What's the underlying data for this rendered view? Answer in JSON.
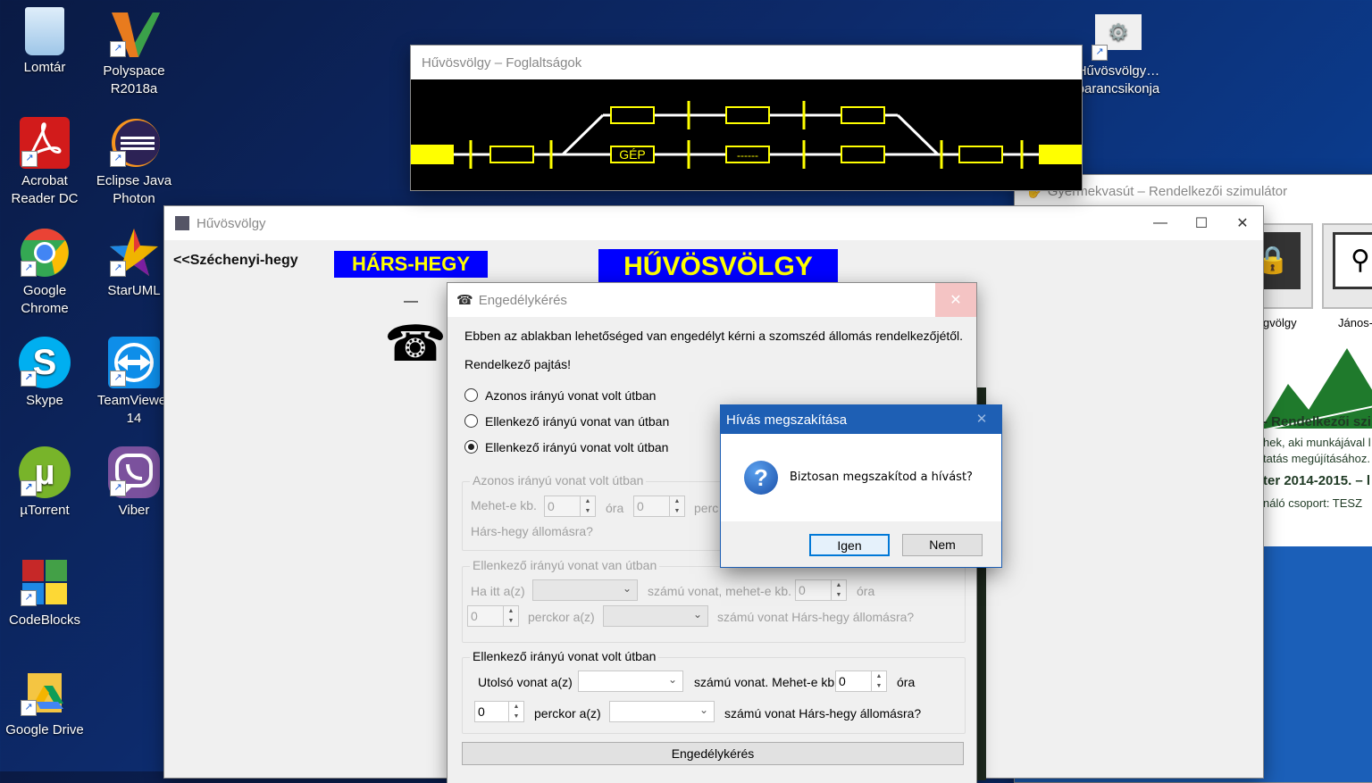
{
  "desktop": {
    "icons": [
      {
        "label": "Lomtár",
        "icon": "recycle-bin-icon",
        "color": "#9ec6e8"
      },
      {
        "label": "Polyspace R2018a",
        "icon": "polyspace-icon",
        "color": "#e87b1e"
      },
      {
        "label": "Acrobat Reader DC",
        "icon": "acrobat-icon",
        "color": "#d21b1b"
      },
      {
        "label": "Eclipse Java Photon",
        "icon": "eclipse-icon",
        "color": "#2c2255"
      },
      {
        "label": "Google Chrome",
        "icon": "chrome-icon",
        "color": "#34a853"
      },
      {
        "label": "StarUML",
        "icon": "staruml-icon",
        "color": "#f0b400"
      },
      {
        "label": "Skype",
        "icon": "skype-icon",
        "color": "#00aff0"
      },
      {
        "label": "TeamViewer 14",
        "icon": "teamviewer-icon",
        "color": "#0e8ee9"
      },
      {
        "label": "µTorrent",
        "icon": "utorrent-icon",
        "color": "#78b42a"
      },
      {
        "label": "Viber",
        "icon": "viber-icon",
        "color": "#7b519d"
      },
      {
        "label": "CodeBlocks",
        "icon": "codeblocks-icon",
        "color": "#c62828"
      },
      {
        "label": "Google Drive",
        "icon": "google-drive-icon",
        "color": "#f4b400"
      },
      {
        "label": "Hűvösvölgy… parancsikonja",
        "icon": "settings-shortcut-icon",
        "color": "#e0e0e0"
      }
    ]
  },
  "occupancy_window": {
    "title": "Hűvösvölgy – Foglaltságok",
    "track_labels": [
      "GÉP",
      "------"
    ]
  },
  "simulator_window": {
    "title": "Gyermekvasút – Rendelkezői szimulátor",
    "station_labels": [
      "gvölgy",
      "János-"
    ],
    "banner_lines": [
      "- Rendelkezői szi",
      "hek, aki munkájával l",
      "tatás megújításához.",
      "ter 2014-2015. – l",
      "náló csoport: TESZ"
    ]
  },
  "station_window": {
    "title": "Hűvösvölgy",
    "back_link": "<<Széchenyi-hegy",
    "neighbor_station": "HÁRS-HEGY",
    "current_station": "HŰVÖSVÖLGY",
    "dash": "—",
    "phone_glyph": "☎"
  },
  "permission_dialog": {
    "title": "Engedélykérés",
    "intro": "Ebben az ablakban lehetőséged van engedélyt kérni a szomszéd állomás rendelkezőjétől.",
    "greeting": "Rendelkező pajtás!",
    "options": [
      {
        "label": "Azonos irányú vonat volt útban",
        "selected": false
      },
      {
        "label": "Ellenkező irányú vonat van útban",
        "selected": false
      },
      {
        "label": "Ellenkező irányú vonat volt útban",
        "selected": true
      }
    ],
    "group1": {
      "title": "Azonos irányú vonat volt útban",
      "can_go": "Mehet-e kb.",
      "hour_value": "0",
      "hour": "óra",
      "min_value": "0",
      "min": "perc",
      "dest": "Hárs-hegy állomásra?"
    },
    "group2": {
      "title": "Ellenkező irányú vonat van útban",
      "if_here": "Ha itt a(z)",
      "train_can_go": "számú vonat, mehet-e kb.",
      "hour_value": "0",
      "hour": "óra",
      "min_value": "0",
      "min_label": "perckor a(z)",
      "dest": "számú vonat Hárs-hegy állomásra?"
    },
    "group3": {
      "title": "Ellenkező irányú vonat volt útban",
      "last_train": "Utolsó vonat a(z)",
      "train_can_go": "számú vonat. Mehet-e kb.",
      "hour_value": "0",
      "hour": "óra",
      "min_value": "0",
      "min_label": "perckor a(z)",
      "dest": "számú vonat Hárs-hegy állomásra?"
    },
    "submit_label": "Engedélykérés"
  },
  "confirm_dialog": {
    "title": "Hívás megszakítása",
    "message": "Biztosan megszakítod a hívást?",
    "yes_label": "Igen",
    "no_label": "Nem",
    "icon": "question-icon"
  }
}
